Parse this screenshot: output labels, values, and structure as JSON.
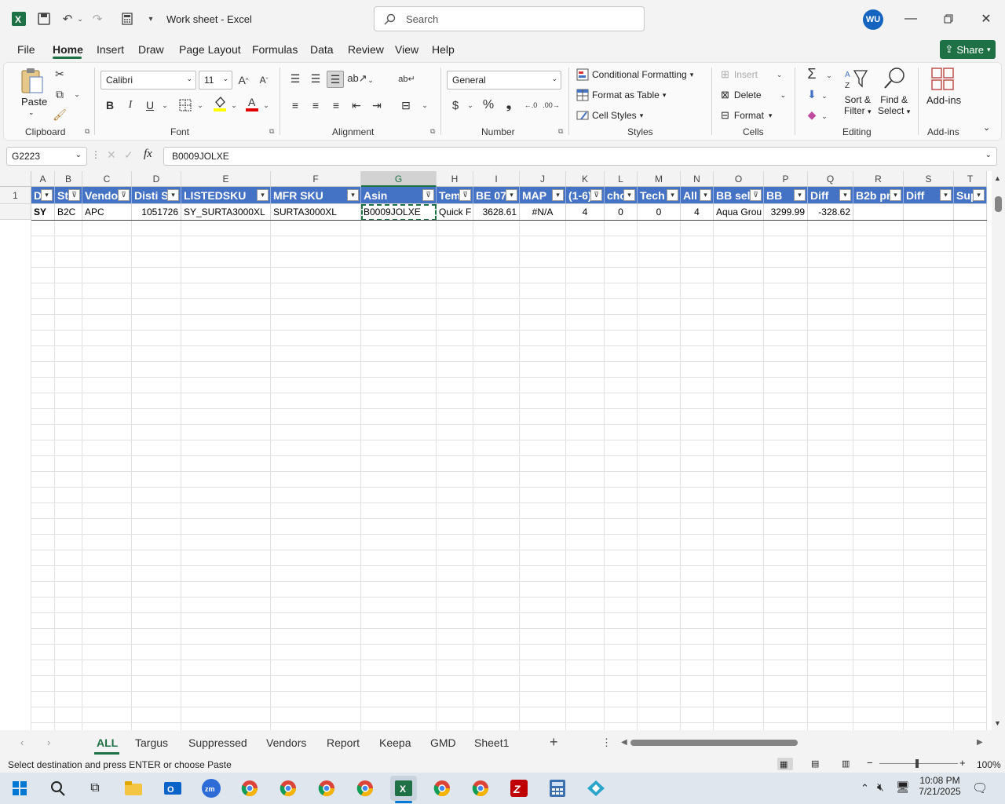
{
  "window": {
    "title": "Work sheet  -  Excel",
    "user_initials": "WU",
    "search_placeholder": "Search"
  },
  "menu": {
    "items": [
      "File",
      "Home",
      "Insert",
      "Draw",
      "Page Layout",
      "Formulas",
      "Data",
      "Review",
      "View",
      "Help"
    ],
    "active": "Home",
    "share_label": "Share"
  },
  "ribbon": {
    "clipboard": {
      "paste": "Paste",
      "label": "Clipboard"
    },
    "font": {
      "name": "Calibri",
      "size": "11",
      "bold": "B",
      "italic": "I",
      "underline": "U",
      "label": "Font"
    },
    "alignment": {
      "label": "Alignment"
    },
    "number": {
      "format": "General",
      "label": "Number"
    },
    "styles": {
      "conditional": "Conditional Formatting",
      "format_table": "Format as Table",
      "cell_styles": "Cell Styles",
      "label": "Styles"
    },
    "cells": {
      "insert": "Insert",
      "delete": "Delete",
      "format": "Format",
      "label": "Cells"
    },
    "editing": {
      "sort_filter_1": "Sort &",
      "sort_filter_2": "Filter",
      "find_1": "Find &",
      "find_2": "Select",
      "label": "Editing"
    },
    "addins": {
      "name": "Add-ins",
      "label": "Add-ins"
    }
  },
  "formula": {
    "name_box": "G2223",
    "fx": "fx",
    "content": "B0009JOLXE"
  },
  "sheet": {
    "columns": [
      "A",
      "B",
      "C",
      "D",
      "E",
      "F",
      "G",
      "H",
      "I",
      "J",
      "K",
      "L",
      "M",
      "N",
      "O",
      "P",
      "Q",
      "R",
      "S",
      "T"
    ],
    "selected_column": "G",
    "row_labels": [
      "1"
    ],
    "headers": [
      "D",
      "St",
      "Vendo",
      "Disti S",
      "LISTEDSKU",
      "MFR SKU",
      "Asin",
      "Tem",
      "BE 07.",
      "MAP",
      "(1-6)",
      "chc",
      "Tech",
      "All",
      "BB sell",
      "BB",
      "Diff",
      "B2b pr",
      "Diff",
      "Sup"
    ],
    "row": [
      "SY",
      "B2C",
      "APC",
      "1051726",
      "SY_SURTA3000XL",
      "SURTA3000XL",
      "B0009JOLXE",
      "Quick F",
      "3628.61",
      "#N/A",
      "4",
      "0",
      "0",
      "4",
      "Aqua Grou",
      "3299.99",
      "-328.62",
      "",
      "",
      ""
    ]
  },
  "tabs": {
    "items": [
      "ALL",
      "Targus",
      "Suppressed",
      "Vendors",
      "Report",
      "Keepa",
      "GMD",
      "Sheet1"
    ],
    "active": "ALL"
  },
  "status": {
    "message": "Select destination and press ENTER or choose Paste",
    "zoom": "100%"
  },
  "taskbar": {
    "time": "10:08 PM",
    "date": "7/21/2025"
  },
  "colors": {
    "excel_green": "#1e7145",
    "header_blue": "#4472c4"
  }
}
